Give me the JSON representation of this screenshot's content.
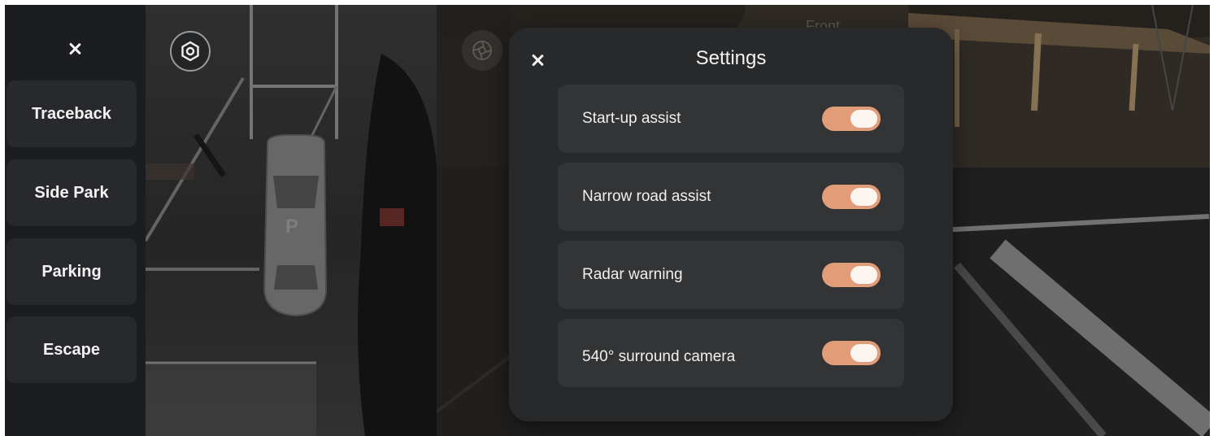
{
  "sidebar": {
    "items": [
      {
        "label": "Traceback"
      },
      {
        "label": "Side Park"
      },
      {
        "label": "Parking"
      },
      {
        "label": "Escape"
      }
    ]
  },
  "surround_view": {
    "parking_marker": "P",
    "camera_label": "Front"
  },
  "settings": {
    "title": "Settings",
    "items": [
      {
        "label": "Start-up assist",
        "enabled": true
      },
      {
        "label": "Narrow road assist",
        "enabled": true
      },
      {
        "label": "Radar warning",
        "enabled": true
      },
      {
        "label": "540° surround camera",
        "enabled": true
      }
    ]
  },
  "colors": {
    "toggle_on": "#e29c78",
    "panel_bg": "#28292b",
    "menu_bg": "#1c1d20"
  },
  "icons": {
    "menu_close": "close-icon",
    "settings": "gear-icon",
    "view_mode": "aperture-icon",
    "panel_close": "close-icon"
  }
}
